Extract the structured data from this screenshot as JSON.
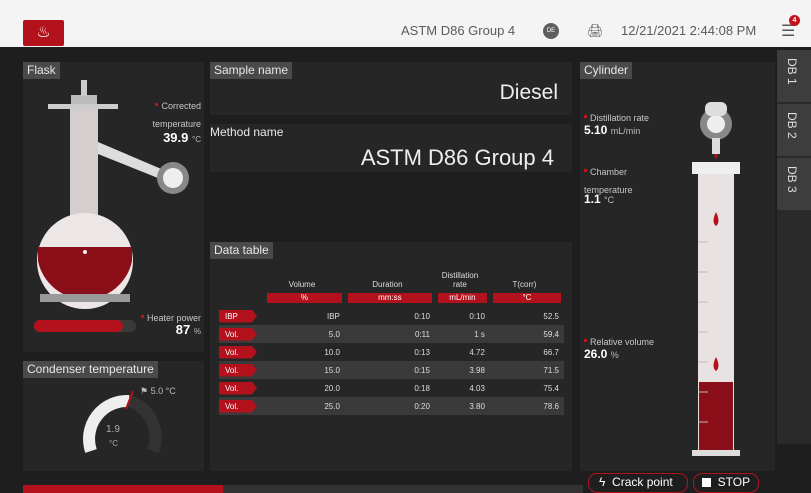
{
  "header": {
    "app_title": "ASTM D86 Group 4",
    "lang_badge": "DE",
    "datetime": "12/21/2021 2:44:08 PM",
    "notif_count": "4",
    "logo_icon": "flask-thermometer-icon"
  },
  "flask": {
    "title": "Flask",
    "corrected_label": "Corrected temperature",
    "corrected_value": "39.9",
    "corrected_unit": "°C",
    "heater_label": "Heater power",
    "heater_value": "87",
    "heater_unit": "%",
    "heater_fraction": 0.87
  },
  "condenser": {
    "title": "Condenser temperature",
    "setpoint": "5.0 °C",
    "value": "1.9",
    "unit": "°C"
  },
  "sample": {
    "label": "Sample name",
    "value": "Diesel"
  },
  "method": {
    "label": "Method name",
    "value": "ASTM D86 Group 4"
  },
  "datatable": {
    "title": "Data table",
    "headers": [
      "Volume",
      "Duration",
      "Distillation rate",
      "T(corr)"
    ],
    "units": [
      "%",
      "mm:ss",
      "mL/min",
      "°C"
    ],
    "rows": [
      {
        "tag": "IBP",
        "vol": "IBP",
        "dur": "0:10",
        "rate": "0:10",
        "t": "52.5"
      },
      {
        "tag": "Vol.",
        "vol": "5.0",
        "dur": "0:11",
        "rate": "1 s",
        "t": "59.4"
      },
      {
        "tag": "Vol.",
        "vol": "10.0",
        "dur": "0:13",
        "rate": "4.72",
        "t": "66.7"
      },
      {
        "tag": "Vol.",
        "vol": "15.0",
        "dur": "0:15",
        "rate": "3.98",
        "t": "71.5"
      },
      {
        "tag": "Vol.",
        "vol": "20.0",
        "dur": "0:18",
        "rate": "4.03",
        "t": "75.4"
      },
      {
        "tag": "Vol.",
        "vol": "25.0",
        "dur": "0:20",
        "rate": "3.80",
        "t": "78.6"
      }
    ]
  },
  "cylinder": {
    "title": "Cylinder",
    "rate_label": "Distillation rate",
    "rate_value": "5.10",
    "rate_unit": "mL/min",
    "chamber_label": "Chamber temperature",
    "chamber_value": "1.1",
    "chamber_unit": "°C",
    "relvol_label": "Relative volume",
    "relvol_value": "26.0",
    "relvol_unit": "%"
  },
  "tabs": [
    "DB 1",
    "DB 2",
    "DB 3"
  ],
  "buttons": {
    "crack": "Crack point",
    "stop": "STOP"
  },
  "colors": {
    "accent": "#b3121d"
  }
}
